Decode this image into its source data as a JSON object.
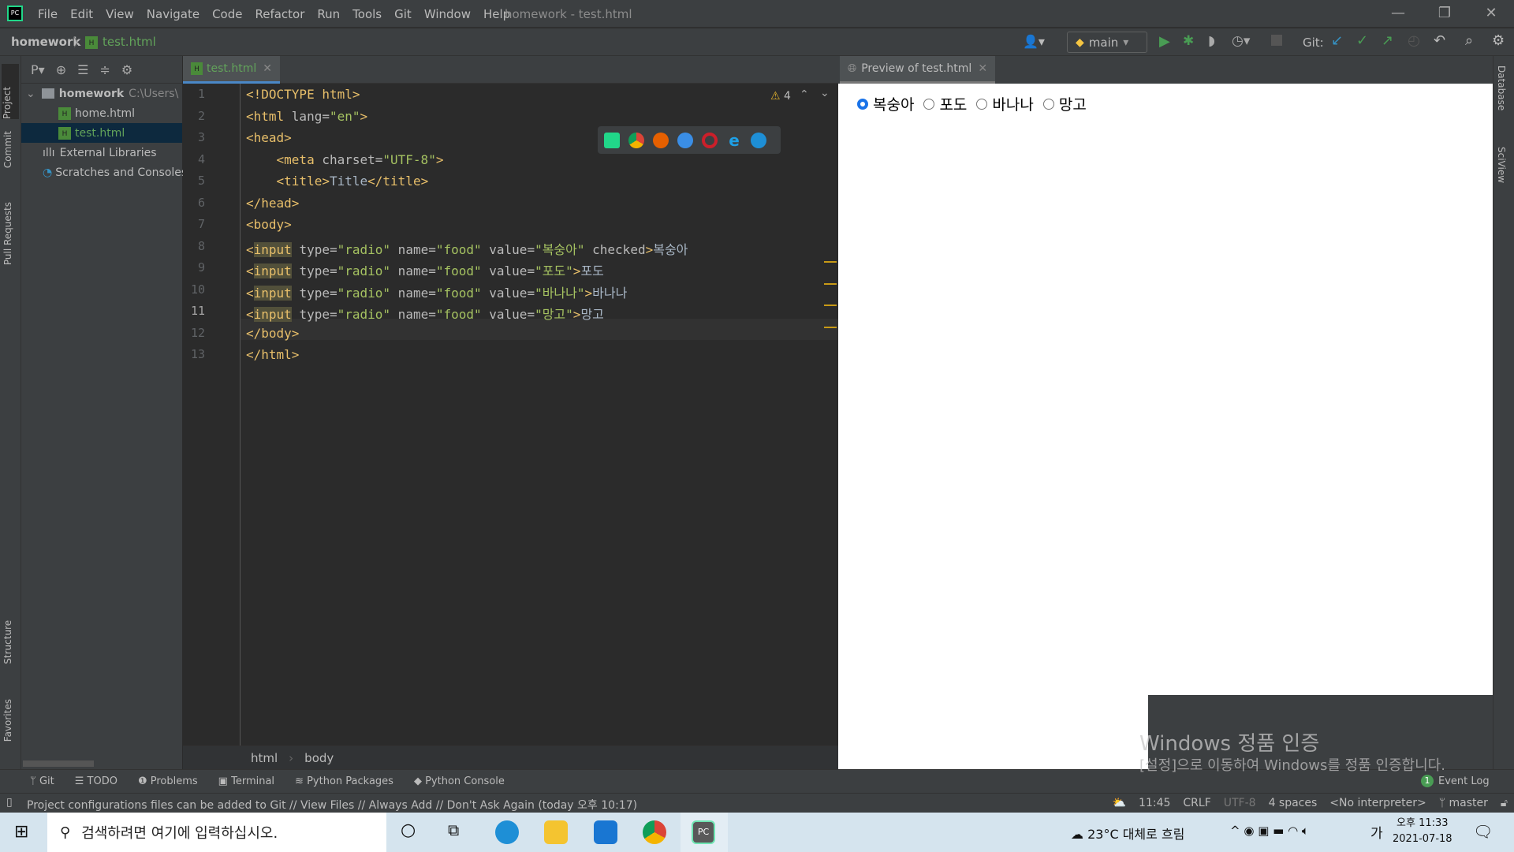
{
  "titlebar": {
    "menu": [
      "File",
      "Edit",
      "View",
      "Navigate",
      "Code",
      "Refactor",
      "Run",
      "Tools",
      "Git",
      "Window",
      "Help"
    ],
    "title": "homework - test.html"
  },
  "navbar": {
    "project": "homework",
    "file": "test.html",
    "run_config": "main",
    "git_label": "Git:"
  },
  "left_strip": [
    "Project",
    "Commit",
    "Pull Requests",
    "Structure",
    "Favorites"
  ],
  "right_strip": [
    "Database",
    "SciView"
  ],
  "project": {
    "toolbar_label": "P▾",
    "root": "homework",
    "root_path": "C:\\Users\\",
    "files": [
      "home.html",
      "test.html"
    ],
    "selected": "test.html",
    "external": "External Libraries",
    "scratches": "Scratches and Consoles"
  },
  "editor": {
    "tab": "test.html",
    "warnings": "4",
    "lines": [
      {
        "n": "1",
        "parts": [
          [
            "tag",
            "<!DOCTYPE html>"
          ]
        ]
      },
      {
        "n": "2",
        "parts": [
          [
            "tag",
            "<html "
          ],
          [
            "at",
            "lang="
          ],
          [
            "av",
            "\"en\""
          ],
          [
            "tag",
            ">"
          ]
        ]
      },
      {
        "n": "3",
        "parts": [
          [
            "tag",
            "<head>"
          ]
        ]
      },
      {
        "n": "4",
        "parts": [
          [
            "tag",
            "    <meta "
          ],
          [
            "at",
            "charset="
          ],
          [
            "av",
            "\"UTF-8\""
          ],
          [
            "tag",
            ">"
          ]
        ]
      },
      {
        "n": "5",
        "parts": [
          [
            "tag",
            "    <title>"
          ],
          [
            "tx",
            "Title"
          ],
          [
            "tag",
            "</title>"
          ]
        ]
      },
      {
        "n": "6",
        "parts": [
          [
            "tag",
            "</head>"
          ]
        ]
      },
      {
        "n": "7",
        "parts": [
          [
            "tag",
            "<body>"
          ]
        ]
      },
      {
        "n": "8",
        "parts": [
          [
            "tag",
            "<"
          ],
          [
            "hl",
            "input"
          ],
          [
            "at",
            " type="
          ],
          [
            "av",
            "\"radio\""
          ],
          [
            "at",
            " name="
          ],
          [
            "av",
            "\"food\""
          ],
          [
            "at",
            " value="
          ],
          [
            "av",
            "\"복숭아\""
          ],
          [
            "at",
            " checked"
          ],
          [
            "tag",
            ">"
          ],
          [
            "tx",
            "복숭아"
          ]
        ]
      },
      {
        "n": "9",
        "parts": [
          [
            "tag",
            "<"
          ],
          [
            "hl",
            "input"
          ],
          [
            "at",
            " type="
          ],
          [
            "av",
            "\"radio\""
          ],
          [
            "at",
            " name="
          ],
          [
            "av",
            "\"food\""
          ],
          [
            "at",
            " value="
          ],
          [
            "av",
            "\"포도\""
          ],
          [
            "tag",
            ">"
          ],
          [
            "tx",
            "포도"
          ]
        ]
      },
      {
        "n": "10",
        "parts": [
          [
            "tag",
            "<"
          ],
          [
            "hl",
            "input"
          ],
          [
            "at",
            " type="
          ],
          [
            "av",
            "\"radio\""
          ],
          [
            "at",
            " name="
          ],
          [
            "av",
            "\"food\""
          ],
          [
            "at",
            " value="
          ],
          [
            "av",
            "\"바나나\""
          ],
          [
            "tag",
            ">"
          ],
          [
            "tx",
            "바나나"
          ]
        ]
      },
      {
        "n": "11",
        "parts": [
          [
            "tag",
            "<"
          ],
          [
            "hl",
            "input"
          ],
          [
            "at",
            " type="
          ],
          [
            "av",
            "\"radio\""
          ],
          [
            "at",
            " name="
          ],
          [
            "av",
            "\"food\""
          ],
          [
            "at",
            " value="
          ],
          [
            "av",
            "\"망고\""
          ],
          [
            "tag",
            ">"
          ],
          [
            "tx",
            "망고"
          ]
        ]
      },
      {
        "n": "12",
        "parts": [
          [
            "tag",
            "</body>"
          ]
        ]
      },
      {
        "n": "13",
        "parts": [
          [
            "tag",
            "</html>"
          ]
        ]
      }
    ],
    "breadcrumbs": [
      "html",
      "body"
    ]
  },
  "preview": {
    "tab": "Preview of test.html",
    "options": [
      {
        "label": "복숭아",
        "checked": true
      },
      {
        "label": "포도",
        "checked": false
      },
      {
        "label": "바나나",
        "checked": false
      },
      {
        "label": "망고",
        "checked": false
      }
    ]
  },
  "tool_tabs": [
    "Git",
    "TODO",
    "Problems",
    "Terminal",
    "Python Packages",
    "Python Console"
  ],
  "event_log": {
    "count": "1",
    "label": "Event Log"
  },
  "status": {
    "message": "Project configurations files can be added to Git // View Files // Always Add // Don't Ask Again (today 오후 10:17)",
    "position": "11:45",
    "line_sep": "CRLF",
    "encoding": "UTF-8",
    "indent": "4 spaces",
    "interpreter": "<No interpreter>",
    "branch": "master"
  },
  "watermark": {
    "title": "Windows 정품 인증",
    "subtitle": "[설정]으로 이동하여 Windows를 정품 인증합니다."
  },
  "taskbar": {
    "search_placeholder": "검색하려면 여기에 입력하십시오.",
    "weather": "23°C 대체로 흐림",
    "ime": "가",
    "time": "오후 11:33",
    "date": "2021-07-18"
  },
  "colors": {
    "accent": "#4a88c7",
    "bg": "#2b2b2b",
    "panel": "#3c3f41"
  }
}
